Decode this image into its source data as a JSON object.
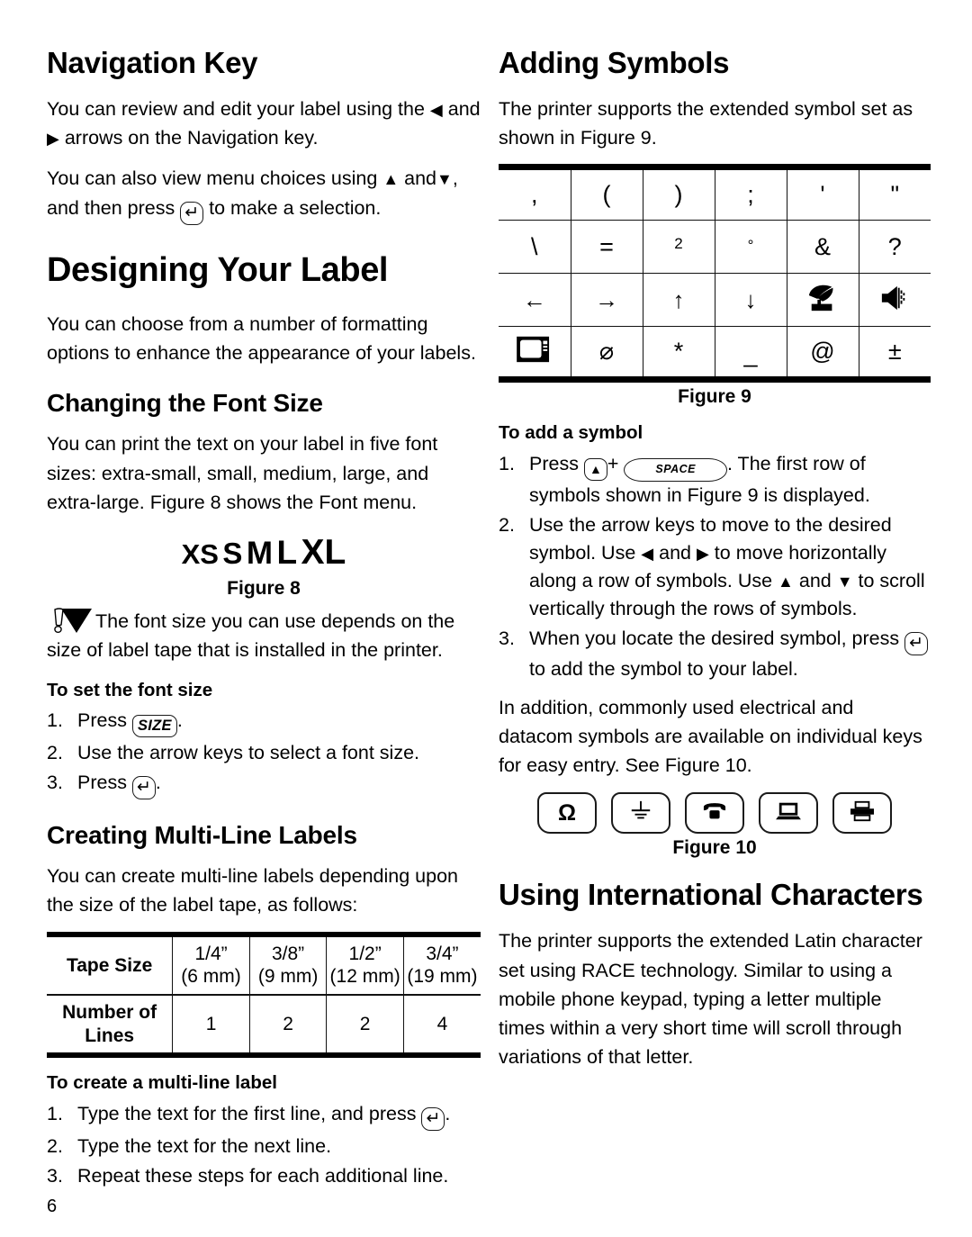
{
  "page": {
    "number": "6"
  },
  "left": {
    "navigation": {
      "heading": "Navigation Key",
      "p1_a": "You can review and edit your label using the",
      "p1_b": "and",
      "p1_c": "arrows on the Navigation key.",
      "p2_a": "You can also view menu choices using",
      "p2_b": "and",
      "p2_c": ", and then press",
      "p2_d": "to make a selection."
    },
    "designing": {
      "heading": "Designing Your Label",
      "paragraph": "You can choose from a number of formatting options to enhance the appearance of your labels."
    },
    "font_size": {
      "heading": "Changing the Font Size",
      "paragraph": "You can print the text on your label in five font sizes: extra-small, small, medium, large, and extra-large. Figure 8 shows the Font menu.",
      "figure_sizes": [
        "XS",
        "S",
        "M",
        "L",
        "XL"
      ],
      "figure_caption": "Figure 8",
      "note": "The font size you can use depends on the size of label tape that is installed in the printer.",
      "procedure_title": "To set the font size",
      "steps": [
        {
          "pre": "Press",
          "key": "SIZE",
          "post": "."
        },
        {
          "pre": "Use the arrow keys to select a font size.",
          "key": "",
          "post": ""
        },
        {
          "pre": "Press",
          "key": "↵",
          "post": "."
        }
      ]
    },
    "multiline": {
      "heading": "Creating Multi-Line Labels",
      "paragraph": "You can create multi-line labels depending upon the size of the label tape, as follows:",
      "table": {
        "row_labels": [
          "Tape Size",
          "Number of Lines"
        ],
        "sizes_inch": [
          "1/4”",
          "3/8”",
          "1/2”",
          "3/4”"
        ],
        "sizes_mm": [
          "(6 mm)",
          "(9 mm)",
          "(12 mm)",
          "(19 mm)"
        ],
        "lines": [
          "1",
          "2",
          "2",
          "4"
        ]
      },
      "procedure_title": "To create a multi-line label",
      "steps": [
        {
          "pre": "Type the text for the first line, and press",
          "key": "↵",
          "post": "."
        },
        {
          "pre": "Type the text for the next line.",
          "key": "",
          "post": ""
        },
        {
          "pre": "Repeat these steps for each additional line.",
          "key": "",
          "post": ""
        }
      ]
    }
  },
  "right": {
    "symbols": {
      "heading": "Adding Symbols",
      "paragraph": "The printer supports the extended symbol set as shown in Figure 9.",
      "table_rows": [
        [
          {
            "type": "text",
            "value": ","
          },
          {
            "type": "text",
            "value": "("
          },
          {
            "type": "text",
            "value": ")"
          },
          {
            "type": "text",
            "value": ";"
          },
          {
            "type": "text",
            "value": "'"
          },
          {
            "type": "text",
            "value": "\""
          }
        ],
        [
          {
            "type": "text",
            "value": "\\"
          },
          {
            "type": "text",
            "value": "="
          },
          {
            "type": "sup",
            "value": "2"
          },
          {
            "type": "deg",
            "value": "°"
          },
          {
            "type": "text",
            "value": "&"
          },
          {
            "type": "text",
            "value": "?"
          }
        ],
        [
          {
            "type": "arrow",
            "value": "←"
          },
          {
            "type": "arrow",
            "value": "→"
          },
          {
            "type": "arrow",
            "value": "↑"
          },
          {
            "type": "arrow",
            "value": "↓"
          },
          {
            "type": "icon",
            "value": "satellite-dish-icon"
          },
          {
            "type": "icon",
            "value": "speaker-icon"
          }
        ],
        [
          {
            "type": "icon",
            "value": "television-icon"
          },
          {
            "type": "text",
            "value": "⌀"
          },
          {
            "type": "text",
            "value": "*"
          },
          {
            "type": "under",
            "value": "_"
          },
          {
            "type": "text",
            "value": "@"
          },
          {
            "type": "text",
            "value": "±"
          }
        ]
      ],
      "figure_caption": "Figure 9",
      "procedure_title": "To add a symbol",
      "step1_pre": "Press",
      "step1_key_up": "▲",
      "step1_plus": "+",
      "step1_key_space": "SPACE",
      "step1_post": ". The first row of symbols shown in Figure 9 is displayed.",
      "step2_a": "Use the arrow keys to move to the desired symbol. Use",
      "step2_b": "and",
      "step2_c": "to move horizontally along a row of symbols. Use",
      "step2_d": "and",
      "step2_e": "to scroll vertically through the rows of symbols.",
      "step3_pre": "When you locate the desired symbol, press",
      "step3_key": "↵",
      "step3_post": "to add the symbol to your label.",
      "closing": "In addition, commonly used electrical and datacom symbols are available on individual keys for easy entry. See Figure 10.",
      "figure10_keys": [
        "ohm-icon",
        "ground-icon",
        "telephone-icon",
        "computer-icon",
        "printer-icon"
      ],
      "figure10_caption": "Figure 10"
    },
    "international": {
      "heading": "Using International Characters",
      "paragraph": "The printer supports the extended Latin character set using RACE technology. Similar to using a mobile phone keypad, typing a letter multiple times within a very short time will scroll through variations of that letter."
    }
  }
}
